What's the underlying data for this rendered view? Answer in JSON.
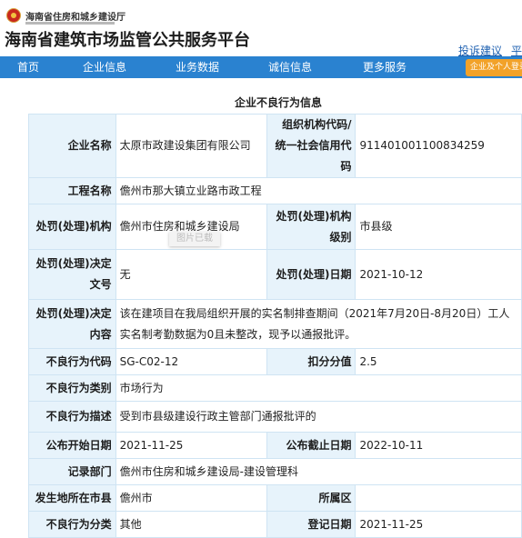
{
  "header": {
    "dept_name": "海南省住房和城乡建设厅",
    "site_title": "海南省建筑市场监管公共服务平台",
    "links": [
      "投诉建议",
      "平"
    ]
  },
  "nav": {
    "items": [
      "首页",
      "企业信息",
      "业务数据",
      "诚信信息",
      "更多服务"
    ],
    "login": "企业及个人登录"
  },
  "section": {
    "title": "企业不良行为信息"
  },
  "record": {
    "company_label": "企业名称",
    "company": "太原市政建设集团有限公司",
    "org_code_label_1": "组织机构代码/",
    "org_code_label_2": "统一社会信用代码",
    "org_code": "911401001100834259",
    "project_label": "工程名称",
    "project": "儋州市那大镇立业路市政工程",
    "agency_label": "处罚(处理)机构",
    "agency": "儋州市住房和城乡建设局",
    "agency_level_label": "处罚(处理)机构级别",
    "agency_level": "市县级",
    "decision_no_label": "处罚(处理)决定文号",
    "decision_no": "无",
    "date_label": "处罚(处理)日期",
    "date": "2021-10-12",
    "content_label": "处罚(处理)决定内容",
    "content": "该在建项目在我局组织开展的实名制排查期间（2021年7月20日-8月20日）工人实名制考勤数据为0且未整改，现予以通报批评。",
    "behavior_code_label": "不良行为代码",
    "behavior_code": "SG-C02-12",
    "points_label": "扣分分值",
    "points": "2.5",
    "category_label": "不良行为类别",
    "category": "市场行为",
    "description_label": "不良行为描述",
    "description": "受到市县级建设行政主管部门通报批评的",
    "pub_start_label": "公布开始日期",
    "pub_start": "2021-11-25",
    "pub_end_label": "公布截止日期",
    "pub_end": "2022-10-11",
    "recorder_label": "记录部门",
    "recorder": "儋州市住房和城乡建设局-建设管理科",
    "city_label": "发生地所在市县",
    "city": "儋州市",
    "district_label": "所属区",
    "district": "",
    "classification_label": "不良行为分类",
    "classification": "其他",
    "record_date_label": "登记日期",
    "record_date": "2021-11-25"
  },
  "watermark": "图片已载"
}
